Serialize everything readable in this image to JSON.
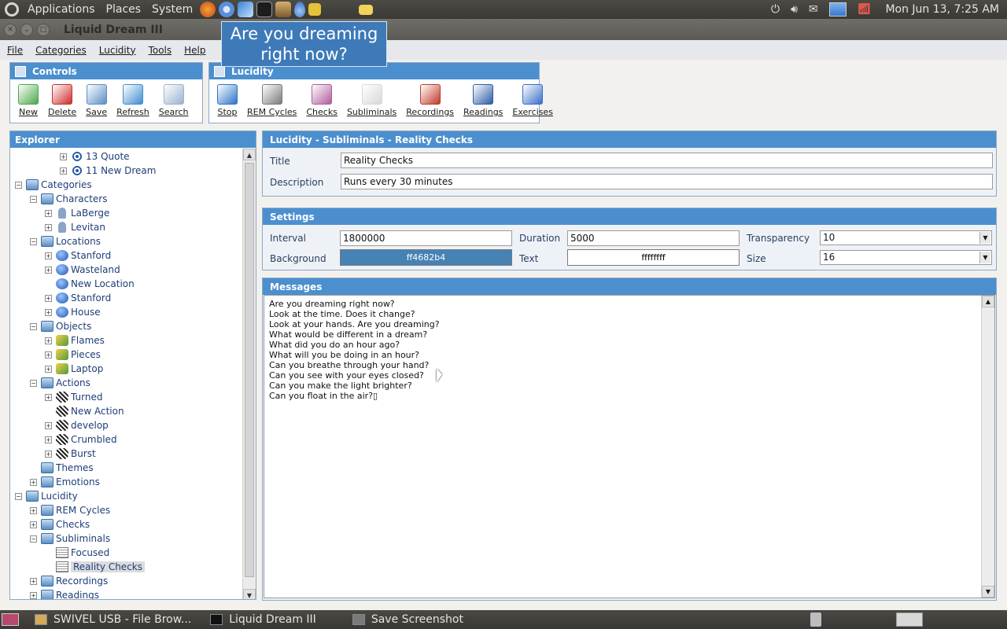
{
  "top_panel": {
    "menus": [
      "Applications",
      "Places",
      "System"
    ],
    "launchers": [
      "firefox-icon",
      "chromium-icon",
      "browser-icon",
      "terminal-icon",
      "gimp-icon",
      "drop-icon",
      "lock-icon",
      "folder-icon"
    ],
    "clock": "Mon Jun 13,  7:25 AM"
  },
  "window": {
    "title": "Liquid Dream III"
  },
  "tooltip": {
    "text": "Are you dreaming right now?"
  },
  "menubar": [
    "File",
    "Categories",
    "Lucidity",
    "Tools",
    "Help"
  ],
  "controls": {
    "title": "Controls",
    "tools": [
      {
        "label": "New",
        "icon": "new-icon",
        "color": "#4aa84a"
      },
      {
        "label": "Delete",
        "icon": "delete-icon",
        "color": "#cc2d2d"
      },
      {
        "label": "Save",
        "icon": "save-icon",
        "color": "#5b8fc4"
      },
      {
        "label": "Refresh",
        "icon": "refresh-icon",
        "color": "#3f8dd0"
      },
      {
        "label": "Search",
        "icon": "search-icon",
        "color": "#9ab3cf"
      }
    ]
  },
  "lucidity_toolbar": {
    "title": "Lucidity",
    "tools": [
      {
        "label": "Stop",
        "icon": "stop-icon",
        "color": "#2d74c9"
      },
      {
        "label": "REM Cycles",
        "icon": "rem-cycles-icon",
        "color": "#7a7a7a"
      },
      {
        "label": "Checks",
        "icon": "checks-icon",
        "color": "#b05c9d"
      },
      {
        "label": "Subliminals",
        "icon": "subliminals-icon",
        "color": "#d8d8d8"
      },
      {
        "label": "Recordings",
        "icon": "recordings-icon",
        "color": "#c0392b"
      },
      {
        "label": "Readings",
        "icon": "readings-icon",
        "color": "#2d5ca8"
      },
      {
        "label": "Exercises",
        "icon": "exercises-icon",
        "color": "#3a6fc9"
      }
    ]
  },
  "explorer": {
    "title": "Explorer",
    "nodes": [
      {
        "label": "13 Quote",
        "icon": "dream",
        "depth": 3,
        "exp": "+"
      },
      {
        "label": "11 New Dream",
        "icon": "dream",
        "depth": 3,
        "exp": "+"
      },
      {
        "label": "Categories",
        "icon": "folder",
        "depth": 0,
        "exp": "−"
      },
      {
        "label": "Characters",
        "icon": "folder",
        "depth": 1,
        "exp": "−"
      },
      {
        "label": "LaBerge",
        "icon": "person",
        "depth": 2,
        "exp": "+"
      },
      {
        "label": "Levitan",
        "icon": "person",
        "depth": 2,
        "exp": "+"
      },
      {
        "label": "Locations",
        "icon": "folder",
        "depth": 1,
        "exp": "−"
      },
      {
        "label": "Stanford",
        "icon": "globe",
        "depth": 2,
        "exp": "+"
      },
      {
        "label": "Wasteland",
        "icon": "globe",
        "depth": 2,
        "exp": "+"
      },
      {
        "label": "New Location",
        "icon": "globe",
        "depth": 2,
        "exp": ""
      },
      {
        "label": "Stanford",
        "icon": "globe",
        "depth": 2,
        "exp": "+"
      },
      {
        "label": "House",
        "icon": "globe",
        "depth": 2,
        "exp": "+"
      },
      {
        "label": "Objects",
        "icon": "folder",
        "depth": 1,
        "exp": "−"
      },
      {
        "label": "Flames",
        "icon": "obj",
        "depth": 2,
        "exp": "+"
      },
      {
        "label": "Pieces",
        "icon": "obj",
        "depth": 2,
        "exp": "+"
      },
      {
        "label": "Laptop",
        "icon": "obj",
        "depth": 2,
        "exp": "+"
      },
      {
        "label": "Actions",
        "icon": "folder",
        "depth": 1,
        "exp": "−"
      },
      {
        "label": "Turned",
        "icon": "action",
        "depth": 2,
        "exp": "+"
      },
      {
        "label": "New Action",
        "icon": "action",
        "depth": 2,
        "exp": ""
      },
      {
        "label": "develop",
        "icon": "action",
        "depth": 2,
        "exp": "+"
      },
      {
        "label": "Crumbled",
        "icon": "action",
        "depth": 2,
        "exp": "+"
      },
      {
        "label": "Burst",
        "icon": "action",
        "depth": 2,
        "exp": "+"
      },
      {
        "label": "Themes",
        "icon": "folder",
        "depth": 1,
        "exp": ""
      },
      {
        "label": "Emotions",
        "icon": "folder",
        "depth": 1,
        "exp": "+"
      },
      {
        "label": "Lucidity",
        "icon": "folder",
        "depth": 0,
        "exp": "−"
      },
      {
        "label": "REM Cycles",
        "icon": "folder",
        "depth": 1,
        "exp": "+"
      },
      {
        "label": "Checks",
        "icon": "folder",
        "depth": 1,
        "exp": "+"
      },
      {
        "label": "Subliminals",
        "icon": "folder",
        "depth": 1,
        "exp": "−"
      },
      {
        "label": "Focused",
        "icon": "note",
        "depth": 2,
        "exp": ""
      },
      {
        "label": "Reality Checks",
        "icon": "note",
        "depth": 2,
        "exp": "",
        "selected": true
      },
      {
        "label": "Recordings",
        "icon": "folder",
        "depth": 1,
        "exp": "+"
      },
      {
        "label": "Readings",
        "icon": "folder",
        "depth": 1,
        "exp": "+"
      }
    ]
  },
  "detail": {
    "header": "Lucidity - Subliminals - Reality Checks",
    "title_label": "Title",
    "title_value": "Reality Checks",
    "description_label": "Description",
    "description_value": "Runs every 30 minutes"
  },
  "settings": {
    "header": "Settings",
    "interval_label": "Interval",
    "interval_value": "1800000",
    "duration_label": "Duration",
    "duration_value": "5000",
    "transparency_label": "Transparency",
    "transparency_value": "10",
    "background_label": "Background",
    "background_value": "ff4682b4",
    "background_color": "#4682b4",
    "text_label": "Text",
    "text_value": "ffffffff",
    "text_color": "#ffffff",
    "size_label": "Size",
    "size_value": "16"
  },
  "messages": {
    "header": "Messages",
    "lines": [
      "Are you dreaming right now?",
      "Look at the time. Does it change?",
      "Look at your hands. Are you dreaming?",
      "What would be different in a dream?",
      "What did you do an hour ago?",
      "What will you be doing in an hour?",
      "Can you breathe through your hand?",
      "Can you see with your eyes closed?",
      "Can you make the light brighter?",
      "Can you float in the air?▯"
    ]
  },
  "taskbar": {
    "tasks": [
      {
        "label": "SWIVEL USB - File Brow...",
        "icon": "file-browser-icon"
      },
      {
        "label": "Liquid Dream III",
        "icon": "app-window-icon"
      },
      {
        "label": "Save Screenshot",
        "icon": "camera-icon"
      }
    ]
  }
}
